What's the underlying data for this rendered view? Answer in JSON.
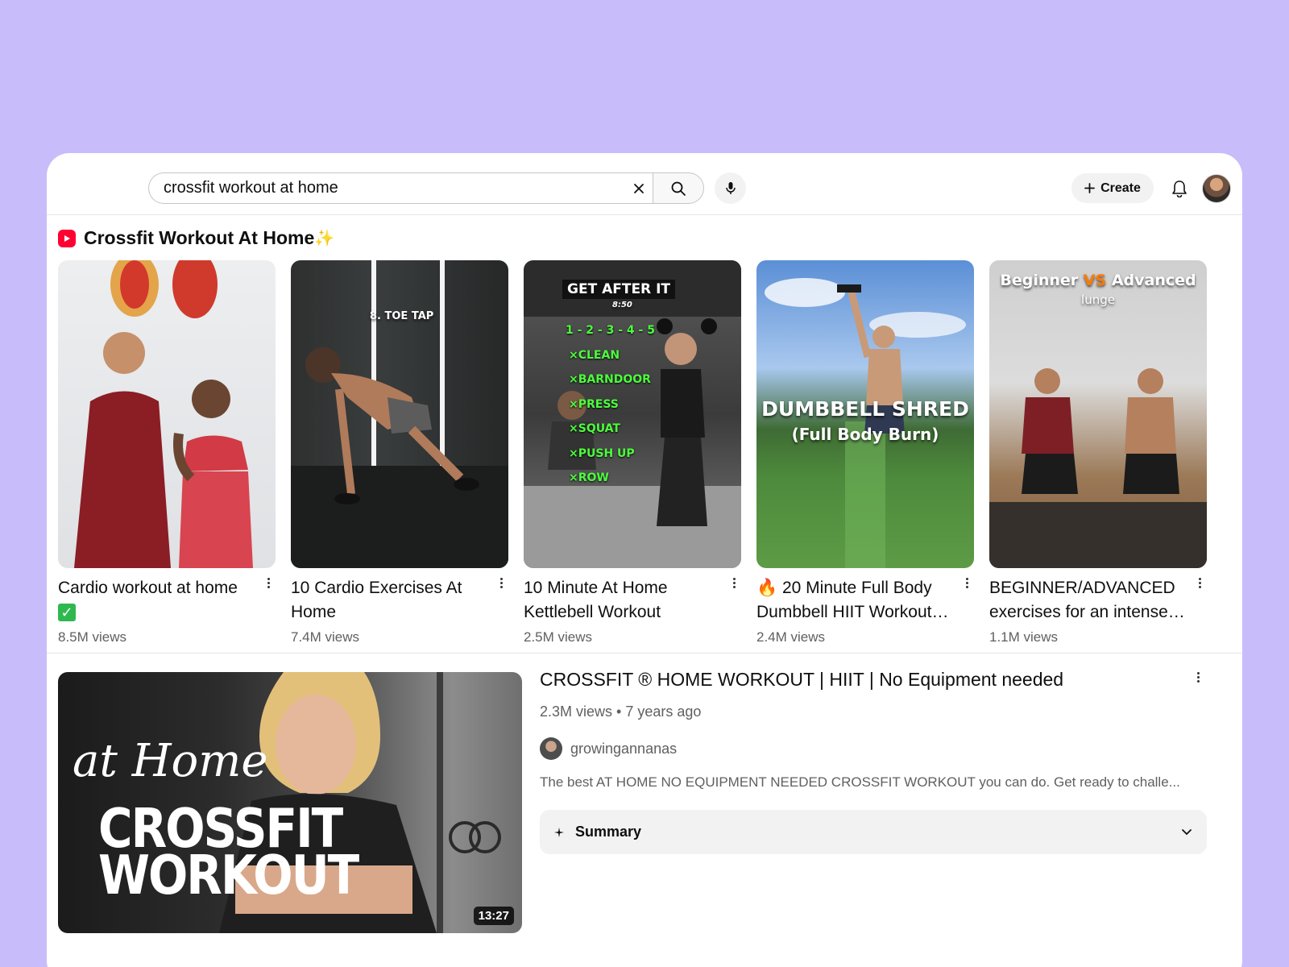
{
  "search": {
    "query": "crossfit workout at home",
    "clear_icon": "close-icon",
    "search_icon": "search-icon",
    "mic_icon": "microphone-icon"
  },
  "header": {
    "create_label": "Create",
    "create_icon": "plus-icon",
    "notifications_icon": "bell-icon"
  },
  "shelf": {
    "title": "Crossfit Workout At Home",
    "sparkle": "✨",
    "logo_color": "#ff0033",
    "items": [
      {
        "title": "Cardio workout at home",
        "title_suffix": "✅",
        "views": "8.5M views"
      },
      {
        "title": "10 Cardio Exercises At Home",
        "views": "7.4M views",
        "overlay": "8. TOE TAP"
      },
      {
        "title": "10 Minute At Home Kettlebell Workout",
        "views": "2.5M views",
        "overlay_title": "GET AFTER IT",
        "overlay_sub": "8:50",
        "overlay_lines": [
          "1 - 2 - 3 - 4 - 5",
          "×CLEAN",
          "×BARNDOOR",
          "×PRESS",
          "×SQUAT",
          "×PUSH UP",
          "×ROW"
        ]
      },
      {
        "title": "🔥 20 Minute Full Body Dumbbell HIIT Workout…",
        "views": "2.4M views",
        "overlay_title": "DUMBBELL SHRED",
        "overlay_sub": "(Full Body Burn)"
      },
      {
        "title": "BEGINNER/ADVANCED exercises for an intense…",
        "views": "1.1M views",
        "overlay_a": "Beginner",
        "overlay_vs": "VS",
        "overlay_b": "Advanced",
        "overlay_sub": "lunge"
      }
    ]
  },
  "video": {
    "title": "CROSSFIT ® HOME WORKOUT | HIIT | No Equipment needed",
    "meta": "2.3M views • 7 years ago",
    "channel": "growingannanas",
    "description": "The best AT HOME NO EQUIPMENT NEEDED CROSSFIT WORKOUT you can do. Get ready to challe...",
    "duration": "13:27",
    "thumb_script": "at Home",
    "thumb_line1": "CROSSFIT",
    "thumb_line2": "WORKOUT",
    "summary_label": "Summary",
    "summary_icon": "sparkle-icon",
    "expand_icon": "chevron-down-icon"
  }
}
